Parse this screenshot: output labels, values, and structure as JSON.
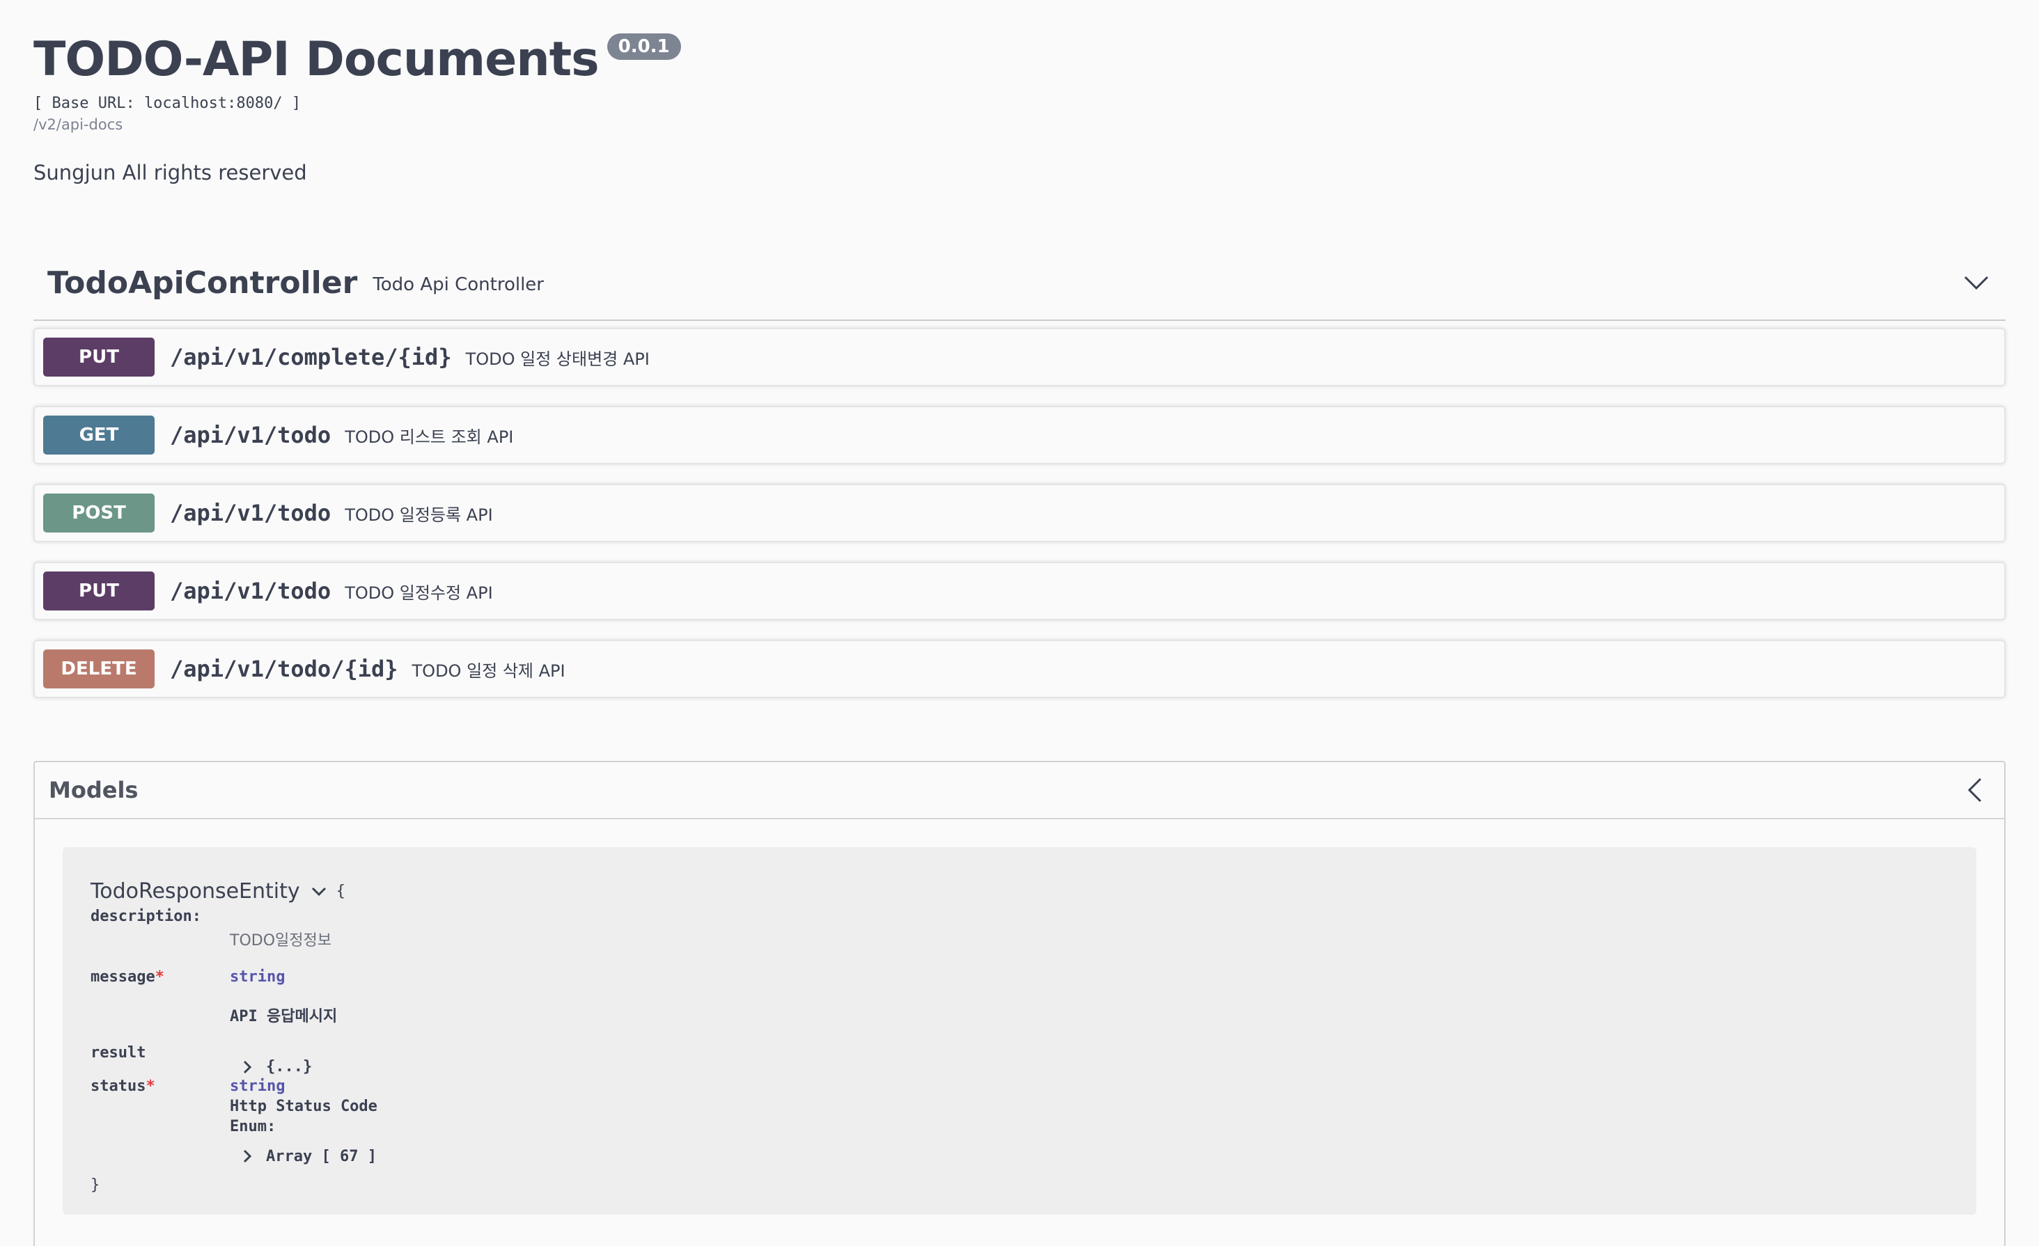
{
  "info": {
    "title": "TODO-API Documents",
    "version": "0.0.1",
    "base_url": "[ Base URL: localhost:8080/ ]",
    "spec_link": "/v2/api-docs",
    "description": "Sungjun All rights reserved"
  },
  "tag": {
    "name": "TodoApiController",
    "description": "Todo Api Controller",
    "toggle_icon": "chevron-down-icon"
  },
  "operations": [
    {
      "method": "PUT",
      "color": "#5c3d66",
      "path": "/api/v1/complete/{id}",
      "summary": "TODO 일정 상태변경 API"
    },
    {
      "method": "GET",
      "color": "#4e7a93",
      "path": "/api/v1/todo",
      "summary": "TODO 리스트 조회 API"
    },
    {
      "method": "POST",
      "color": "#6b9688",
      "path": "/api/v1/todo",
      "summary": "TODO 일정등록 API"
    },
    {
      "method": "PUT",
      "color": "#5c3d66",
      "path": "/api/v1/todo",
      "summary": "TODO 일정수정 API"
    },
    {
      "method": "DELETE",
      "color": "#b97a6c",
      "path": "/api/v1/todo/{id}",
      "summary": "TODO 일정 삭제 API"
    }
  ],
  "models": {
    "title": "Models",
    "toggle_icon": "chevron-left-icon",
    "entity": {
      "name": "TodoResponseEntity",
      "brace_open": "{",
      "brace_close": "}",
      "description_label": "description:",
      "description_value": "TODO일정정보",
      "message_name": "message",
      "message_type": "string",
      "message_desc": "API 응답메시지",
      "result_name": "result",
      "result_value": "{...}",
      "status_name": "status",
      "status_type": "string",
      "status_desc": "Http Status Code",
      "enum_label": "Enum:",
      "enum_value": "Array [ 67 ]",
      "required_mark": "*"
    }
  }
}
